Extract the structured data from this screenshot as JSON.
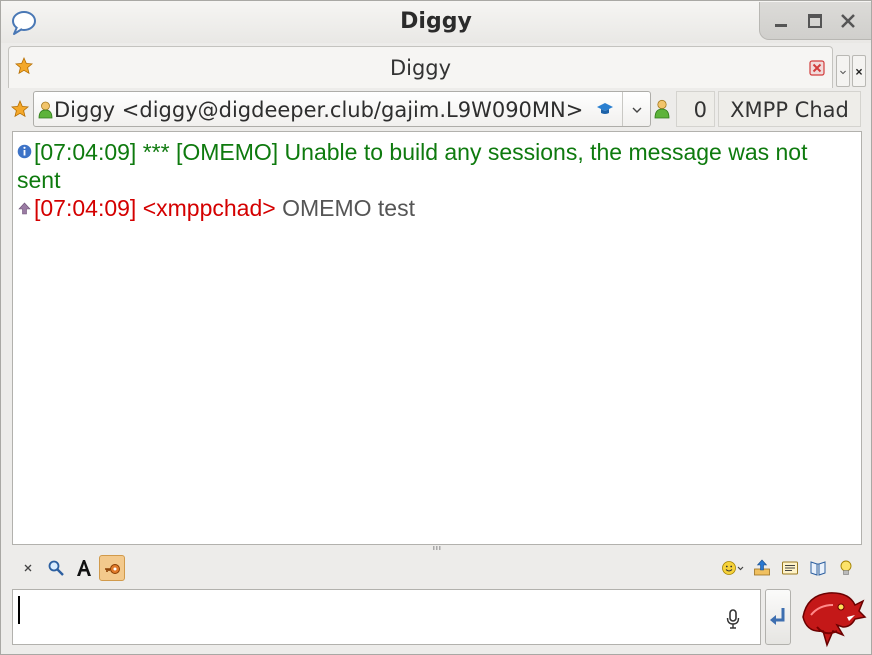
{
  "window": {
    "title": "Diggy"
  },
  "tab": {
    "label": "Diggy"
  },
  "contact": {
    "selector_text": "Diggy <diggy@digdeeper.club/gajim.L9W090MN>",
    "unread_count": "0",
    "account_name": "XMPP Chad"
  },
  "messages": [
    {
      "type": "info",
      "timestamp": "[07:04:09]",
      "text": "*** [OMEMO] Unable to build any sessions, the message was not sent",
      "color": "#0e7a0e"
    },
    {
      "type": "outgoing",
      "timestamp": "[07:04:09]",
      "nick": "<xmppchad>",
      "text": "OMEMO test",
      "nick_color": "#d40000",
      "text_color": "#555555"
    }
  ],
  "toolbar": {
    "left_icons": [
      "clear-icon",
      "search-icon",
      "font-icon",
      "encryption-icon"
    ],
    "right_icons": [
      "emoticon-icon",
      "send-file-icon",
      "formatting-icon",
      "bookmark-icon",
      "tip-icon"
    ]
  },
  "input": {
    "value": "",
    "placeholder": ""
  },
  "colors": {
    "accent": "#f3c98c",
    "info": "#0e7a0e",
    "outgoing": "#d40000"
  }
}
